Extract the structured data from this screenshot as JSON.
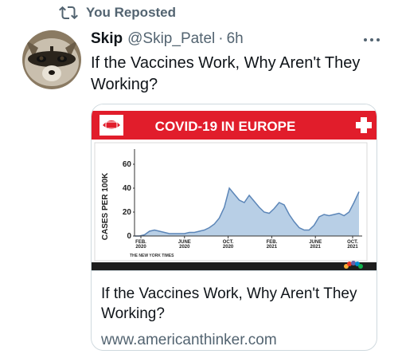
{
  "repost": {
    "icon": "repost-icon",
    "label": "You Reposted"
  },
  "tweet": {
    "display_name": "Skip",
    "handle": "@Skip_Patel",
    "separator": "·",
    "time": "6h",
    "more_icon": "more-options-icon",
    "text": "If the Vaccines Work, Why Aren't They Working?"
  },
  "card": {
    "title": "If the Vaccines Work, Why Aren't They Working?",
    "url": "www.americanthinker.com",
    "image": {
      "banner_title": "COVID-19 IN EUROPE",
      "banner_color": "#e11d2b",
      "source_note": "THE NEW YORK TIMES",
      "logo_icon": "nbc-peacock-icon"
    }
  },
  "chart_data": {
    "type": "area",
    "title": "COVID-19 IN EUROPE",
    "ylabel": "CASES PER 100K",
    "xlabel": "",
    "ylim": [
      0,
      70
    ],
    "yticks": [
      0,
      20,
      40,
      60
    ],
    "xticks": [
      {
        "label": [
          "FEB.",
          "2020"
        ]
      },
      {
        "label": [
          "JUNE",
          "2020"
        ]
      },
      {
        "label": [
          "OCT.",
          "2020"
        ]
      },
      {
        "label": [
          "FEB.",
          "2021"
        ]
      },
      {
        "label": [
          "JUNE",
          "2021"
        ]
      },
      {
        "label": [
          "OCT.",
          "2021"
        ]
      }
    ],
    "grid": false,
    "fill_color": "#b8cfe6",
    "line_color": "#5c86b8",
    "series": [
      {
        "values": [
          0,
          0,
          1,
          4,
          5,
          4,
          3,
          2,
          2,
          2,
          2,
          3,
          3,
          4,
          5,
          7,
          10,
          15,
          24,
          40,
          35,
          30,
          28,
          34,
          29,
          24,
          20,
          19,
          23,
          28,
          26,
          18,
          12,
          7,
          5,
          5,
          9,
          16,
          18,
          17,
          18,
          19,
          17,
          20,
          28,
          37
        ]
      }
    ]
  }
}
